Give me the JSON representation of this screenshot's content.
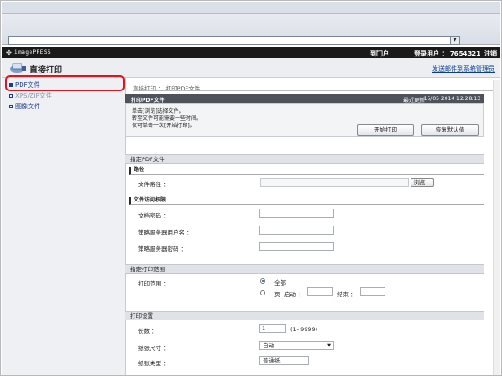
{
  "browser": {
    "address_value": ""
  },
  "brand": {
    "name": "imagePRESS"
  },
  "header": {
    "portal": "到门户",
    "user_label": "登录用户 ： 7654321",
    "logout": "注销",
    "page_title": "直接打印",
    "send_link": "发送邮件到系统管理员"
  },
  "sidebar": {
    "items": [
      {
        "label": "PDF文件",
        "active": true
      },
      {
        "label": "XPS/ZIP文件",
        "active": false
      },
      {
        "label": "图像文件",
        "active": false
      }
    ]
  },
  "main": {
    "breadcrumb": "直接打印 ： 打印PDF文件",
    "panel": {
      "title": "打印PDF文件",
      "updated_label": "最近更新",
      "date": "15/05 2014 12:28:13"
    },
    "instructions": [
      "单击[浏览]选择文件。",
      "转至文件可能需要一些时间。",
      "仅可单击一次[开始打印]。"
    ],
    "buttons": {
      "start": "开始打印",
      "defaults": "恢复默认值"
    },
    "file_section": {
      "title": "指定PDF文件",
      "path_head": "路径",
      "path_label": "文件路径 ：",
      "browse": "浏览...",
      "access_head": "文件访问权限",
      "doc_pw": "文档密码 ：",
      "policy_user": "策略服务器用户名 ：",
      "policy_pw": "策略服务器密码 ："
    },
    "range_section": {
      "title": "指定打印范围",
      "range_label": "打印范围 ：",
      "all": "全部",
      "pages": "页",
      "start": "启动 ：",
      "end": "结束 ："
    },
    "settings": {
      "title": "打印设置",
      "copies_label": "份数 ：",
      "copies_value": "1",
      "copies_hint": "(1- 9999)",
      "paper_label": "纸张尺寸 ：",
      "paper_value": "自动",
      "extra_label": "纸张类型 ：",
      "extra_value": "普通纸"
    }
  },
  "colors": {
    "highlight": "#e0141e",
    "link": "#0a3c94",
    "panel": "#4d525b"
  }
}
